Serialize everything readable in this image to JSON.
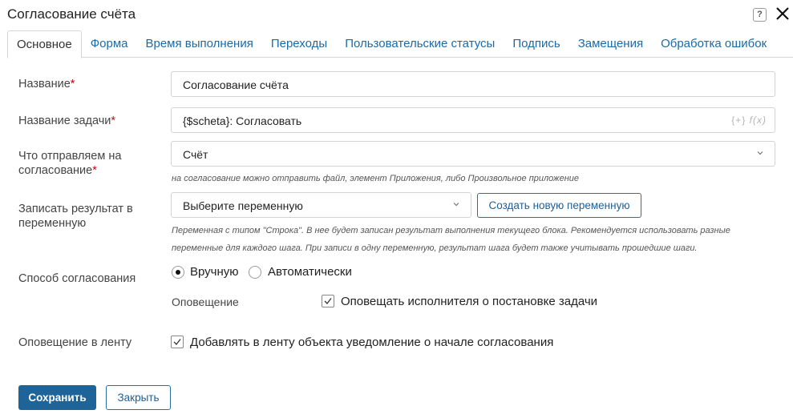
{
  "dialog": {
    "title": "Согласование счёта",
    "help_label": "?"
  },
  "tabs": [
    {
      "label": "Основное",
      "active": true
    },
    {
      "label": "Форма",
      "active": false
    },
    {
      "label": "Время выполнения",
      "active": false
    },
    {
      "label": "Переходы",
      "active": false
    },
    {
      "label": "Пользовательские статусы",
      "active": false
    },
    {
      "label": "Подпись",
      "active": false
    },
    {
      "label": "Замещения",
      "active": false
    },
    {
      "label": "Обработка ошибок",
      "active": false
    }
  ],
  "form": {
    "required_mark": "*",
    "name": {
      "label": "Название",
      "value": "Согласование счёта"
    },
    "task_name": {
      "label": "Название задачи",
      "value": "{$scheta}: Согласовать",
      "insert_var_icon": "{+}",
      "formula_icon": "f(x)"
    },
    "send": {
      "label_line1": "Что отправляем на",
      "label_line2": "согласование",
      "value": "Счёт",
      "hint": "на согласование можно отправить файл, элемент Приложения, либо Произвольное приложение"
    },
    "result_var": {
      "label_line1": "Записать результат в",
      "label_line2": "переменную",
      "placeholder": "Выберите переменную",
      "create_button": "Создать новую переменную",
      "hint_line1": "Переменная с типом \"Строка\". В нее будет записан результат выполнения текущего блока. Рекомендуется использовать разные",
      "hint_line2": "переменные для каждого шага. При записи в одну переменную, результат шага будет также учитывать прошедшие шаги."
    },
    "approval_method": {
      "label": "Способ согласования",
      "options": [
        {
          "label": "Вручную",
          "selected": true
        },
        {
          "label": "Автоматически",
          "selected": false
        }
      ]
    },
    "notification": {
      "label": "Оповещение",
      "checkbox_label": "Оповещать исполнителя о постановке задачи",
      "checked": true
    },
    "feed_notification": {
      "label": "Оповещение в ленту",
      "checkbox_label": "Добавлять в ленту объекта уведомление о начале согласования",
      "checked": true
    }
  },
  "footer": {
    "save_label": "Сохранить",
    "close_label": "Закрыть"
  },
  "colors": {
    "accent": "#1f6499",
    "link": "#1a6aa8",
    "required": "#d0021b"
  }
}
